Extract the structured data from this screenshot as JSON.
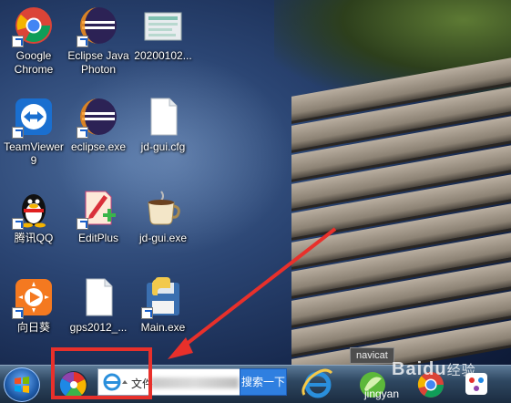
{
  "desktop": {
    "icons": [
      {
        "id": "chrome",
        "label_line1": "Google",
        "label_line2": "Chrome"
      },
      {
        "id": "eclipse-java-photon",
        "label_line1": "Eclipse Java",
        "label_line2": "Photon"
      },
      {
        "id": "image-file",
        "label_line1": "20200102...",
        "label_line2": ""
      },
      {
        "id": "teamviewer",
        "label_line1": "TeamViewer",
        "label_line2": "9"
      },
      {
        "id": "eclipse-exe",
        "label_line1": "eclipse.exe",
        "label_line2": ""
      },
      {
        "id": "jd-gui-cfg",
        "label_line1": "jd-gui.cfg",
        "label_line2": ""
      },
      {
        "id": "qq",
        "label_line1": "腾讯QQ",
        "label_line2": ""
      },
      {
        "id": "editplus",
        "label_line1": "EditPlus",
        "label_line2": ""
      },
      {
        "id": "jd-gui-exe",
        "label_line1": "jd-gui.exe",
        "label_line2": ""
      },
      {
        "id": "sunlogin",
        "label_line1": "向日葵",
        "label_line2": ""
      },
      {
        "id": "gps2012",
        "label_line1": "gps2012_...",
        "label_line2": ""
      },
      {
        "id": "main-exe",
        "label_line1": "Main.exe",
        "label_line2": ""
      }
    ]
  },
  "taskbar": {
    "search": {
      "value": "文件",
      "button_label": "搜索一下"
    },
    "tooltip": "navicat",
    "jingyan_label": "jingyan"
  },
  "watermark": {
    "brand": "Baidu",
    "jingyan": "经验"
  },
  "colors": {
    "annotation": "#e8302b",
    "taskbar": "#1b2c40",
    "search_button": "#2f7fe0"
  }
}
